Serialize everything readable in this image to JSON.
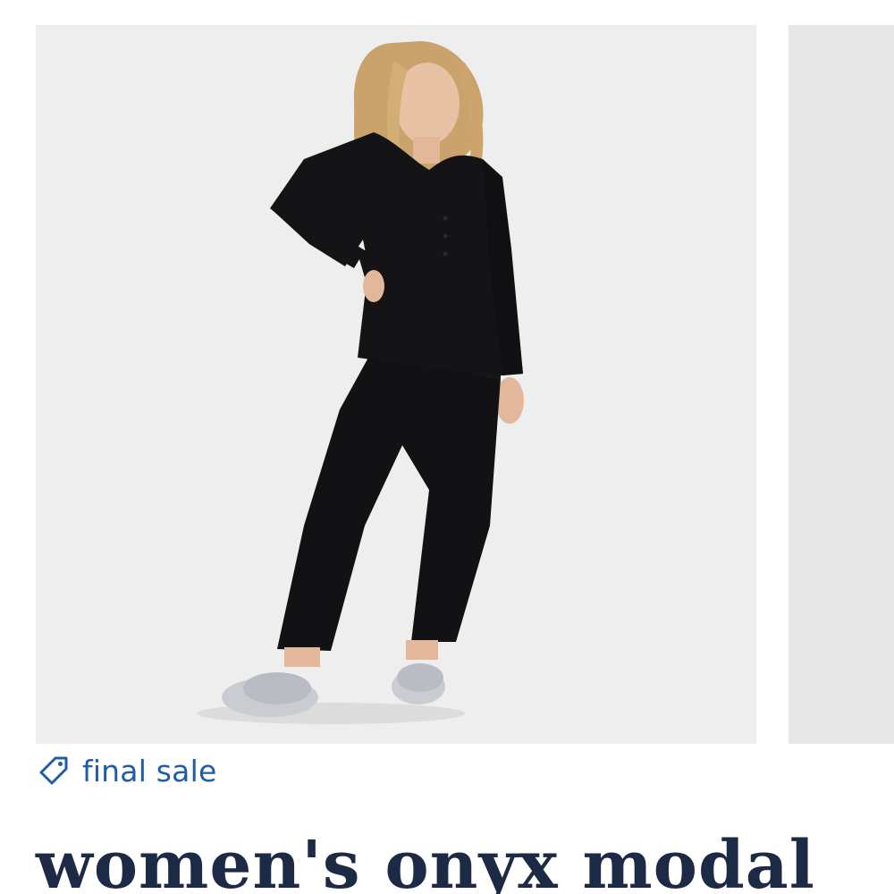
{
  "product": {
    "image_alt": "woman in black long-sleeve henley top and black pants wearing grey fuzzy slides",
    "badge_label": "final sale",
    "title": "women's onyx modal"
  },
  "icons": {
    "badge_icon": "tag-icon"
  },
  "colors": {
    "badge_text": "#1f5da8",
    "title_text": "#1c2a46",
    "image_background": "#eeeeee"
  }
}
